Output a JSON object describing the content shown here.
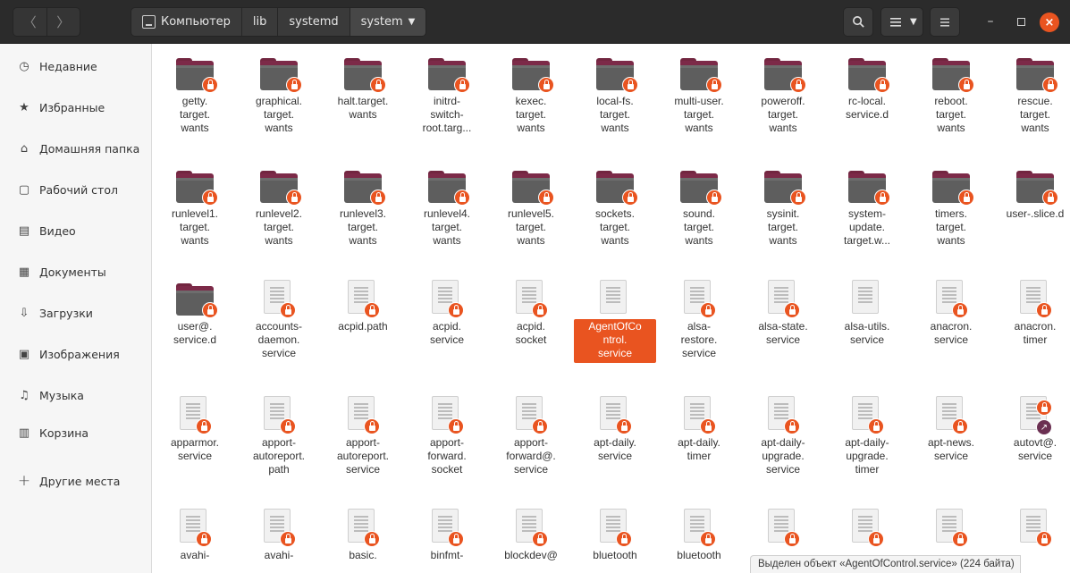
{
  "header": {
    "back": "〈",
    "forward": "〉",
    "path": [
      {
        "label": "Компьютер",
        "icon": "drive-icon"
      },
      {
        "label": "lib"
      },
      {
        "label": "systemd"
      },
      {
        "label": "system",
        "current": true
      }
    ],
    "dropdown_caret": "▼",
    "search_icon": "search-icon",
    "view_icon": "list-view-icon",
    "menu_icon": "hamburger-menu-icon",
    "minimize": "–",
    "close": "×"
  },
  "sidebar": {
    "items": [
      {
        "label": "Недавние",
        "icon": "recent-icon",
        "glyph": "◷"
      },
      {
        "label": "Избранные",
        "icon": "star-icon",
        "glyph": "★"
      },
      {
        "label": "Домашняя папка",
        "icon": "home-icon",
        "glyph": "⌂"
      },
      {
        "label": "Рабочий стол",
        "icon": "desktop-icon",
        "glyph": "▢"
      },
      {
        "label": "Видео",
        "icon": "video-icon",
        "glyph": "▤"
      },
      {
        "label": "Документы",
        "icon": "document-icon",
        "glyph": "▦"
      },
      {
        "label": "Загрузки",
        "icon": "download-icon",
        "glyph": "⇩"
      },
      {
        "label": "Изображения",
        "icon": "image-icon",
        "glyph": "▣"
      },
      {
        "label": "Музыка",
        "icon": "music-icon",
        "glyph": "♫"
      },
      {
        "label": "Корзина",
        "icon": "trash-icon",
        "glyph": "▥"
      },
      {
        "label": "Другие места",
        "icon": "plus-icon",
        "glyph": "+"
      }
    ]
  },
  "files": [
    [
      {
        "name": "getty.\ntarget.\nwants",
        "type": "folder"
      },
      {
        "name": "graphical.\ntarget.\nwants",
        "type": "folder"
      },
      {
        "name": "halt.target.\nwants",
        "type": "folder"
      },
      {
        "name": "initrd-\nswitch-\nroot.targ...",
        "type": "folder"
      },
      {
        "name": "kexec.\ntarget.\nwants",
        "type": "folder"
      },
      {
        "name": "local-fs.\ntarget.\nwants",
        "type": "folder"
      },
      {
        "name": "multi-user.\ntarget.\nwants",
        "type": "folder"
      },
      {
        "name": "poweroff.\ntarget.\nwants",
        "type": "folder"
      },
      {
        "name": "rc-local.\nservice.d",
        "type": "folder"
      },
      {
        "name": "reboot.\ntarget.\nwants",
        "type": "folder"
      },
      {
        "name": "rescue.\ntarget.\nwants",
        "type": "folder"
      }
    ],
    [
      {
        "name": "runlevel1.\ntarget.\nwants",
        "type": "folder"
      },
      {
        "name": "runlevel2.\ntarget.\nwants",
        "type": "folder"
      },
      {
        "name": "runlevel3.\ntarget.\nwants",
        "type": "folder"
      },
      {
        "name": "runlevel4.\ntarget.\nwants",
        "type": "folder"
      },
      {
        "name": "runlevel5.\ntarget.\nwants",
        "type": "folder"
      },
      {
        "name": "sockets.\ntarget.\nwants",
        "type": "folder"
      },
      {
        "name": "sound.\ntarget.\nwants",
        "type": "folder"
      },
      {
        "name": "sysinit.\ntarget.\nwants",
        "type": "folder"
      },
      {
        "name": "system-\nupdate.\ntarget.w...",
        "type": "folder"
      },
      {
        "name": "timers.\ntarget.\nwants",
        "type": "folder"
      },
      {
        "name": "user-.slice.d",
        "type": "folder"
      }
    ],
    [
      {
        "name": "user@.\nservice.d",
        "type": "folder"
      },
      {
        "name": "accounts-\ndaemon.\nservice",
        "type": "file"
      },
      {
        "name": "acpid.path",
        "type": "file"
      },
      {
        "name": "acpid.\nservice",
        "type": "file"
      },
      {
        "name": "acpid.\nsocket",
        "type": "file"
      },
      {
        "name": "AgentOfCo\nntrol.\nservice",
        "type": "file",
        "selected": true,
        "nolock": true
      },
      {
        "name": "alsa-\nrestore.\nservice",
        "type": "file"
      },
      {
        "name": "alsa-state.\nservice",
        "type": "file"
      },
      {
        "name": "alsa-utils.\nservice",
        "type": "file",
        "nolock": true
      },
      {
        "name": "anacron.\nservice",
        "type": "file"
      },
      {
        "name": "anacron.\ntimer",
        "type": "file"
      }
    ],
    [
      {
        "name": "apparmor.\nservice",
        "type": "file"
      },
      {
        "name": "apport-\nautoreport.\npath",
        "type": "file"
      },
      {
        "name": "apport-\nautoreport.\nservice",
        "type": "file"
      },
      {
        "name": "apport-\nforward.\nsocket",
        "type": "file"
      },
      {
        "name": "apport-\nforward@.\nservice",
        "type": "file"
      },
      {
        "name": "apt-daily.\nservice",
        "type": "file"
      },
      {
        "name": "apt-daily.\ntimer",
        "type": "file"
      },
      {
        "name": "apt-daily-\nupgrade.\nservice",
        "type": "file"
      },
      {
        "name": "apt-daily-\nupgrade.\ntimer",
        "type": "file"
      },
      {
        "name": "apt-news.\nservice",
        "type": "file"
      },
      {
        "name": "autovt@.\nservice",
        "type": "file",
        "link": true
      }
    ],
    [
      {
        "name": "avahi-",
        "type": "file"
      },
      {
        "name": "avahi-",
        "type": "file"
      },
      {
        "name": "basic.",
        "type": "file"
      },
      {
        "name": "binfmt-",
        "type": "file"
      },
      {
        "name": "blockdev@",
        "type": "file"
      },
      {
        "name": "bluetooth",
        "type": "file"
      },
      {
        "name": "bluetooth",
        "type": "file"
      },
      {
        "name": "",
        "type": "file"
      },
      {
        "name": "",
        "type": "file"
      },
      {
        "name": "",
        "type": "file"
      },
      {
        "name": "",
        "type": "file"
      }
    ]
  ],
  "status": "Выделен объект «AgentOfControl.service» (224 байта)"
}
